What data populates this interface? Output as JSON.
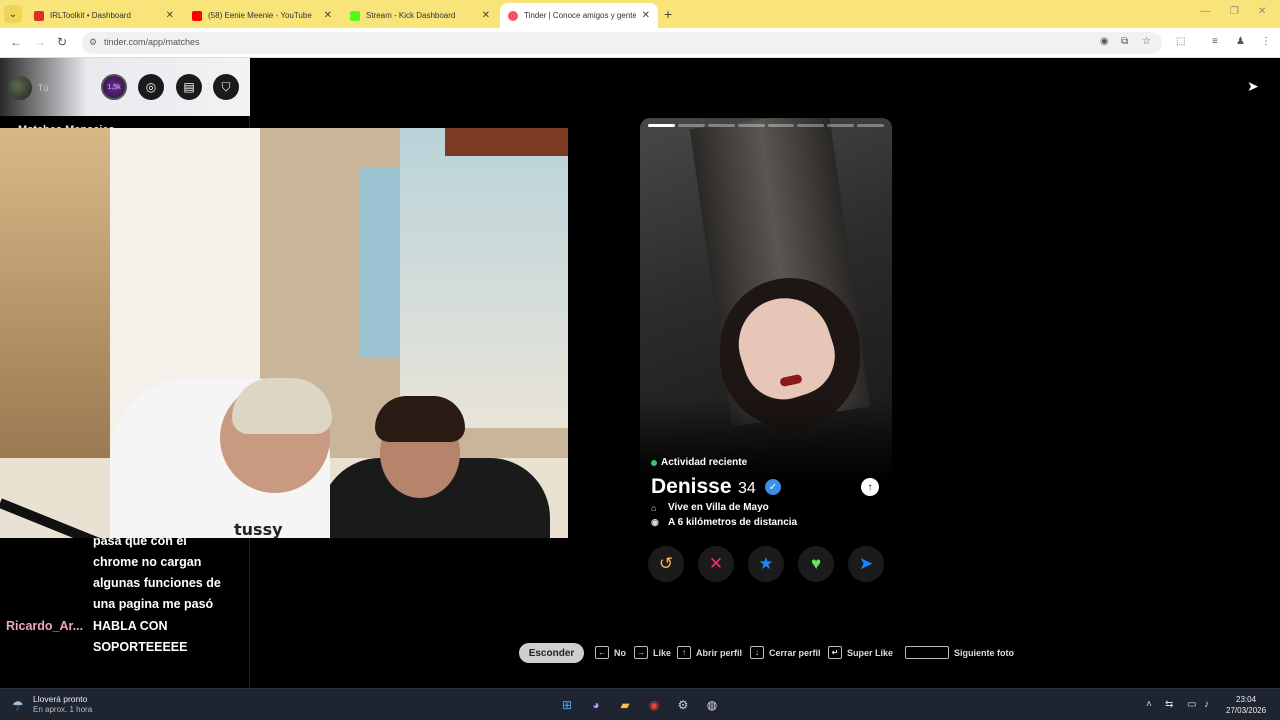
{
  "browser": {
    "tabs": [
      {
        "title": "IRLToolkit • Dashboard",
        "favicon_color": "#d93025"
      },
      {
        "title": "(58) Eenie Meenie - YouTube",
        "favicon_color": "#ff0000"
      },
      {
        "title": "Stream - Kick Dashboard",
        "favicon_color": "#53fc18"
      },
      {
        "title": "Tinder | Conoce amigos y gente",
        "favicon_color": "#fd5068"
      }
    ],
    "active_tab": 3,
    "url": "tinder.com/app/matches"
  },
  "tinder": {
    "you_label": "Tú",
    "gold_badge": "1,5k",
    "matches_heading": "Matches   Mensajes",
    "profile": {
      "activity": "Actividad reciente",
      "name": "Denisse",
      "age": "34",
      "lives_in": "Vive en Villa de Mayo",
      "distance": "A 6 kilómetros de distancia",
      "photo_count": 8,
      "current_photo": 1
    },
    "actions": [
      {
        "name": "rewind",
        "glyph": "↺",
        "color": "#f5b748"
      },
      {
        "name": "nope",
        "glyph": "✕",
        "color": "#fd267d"
      },
      {
        "name": "super-like",
        "glyph": "★",
        "color": "#1786ff"
      },
      {
        "name": "like",
        "glyph": "♥",
        "color": "#6ce45e"
      },
      {
        "name": "boost",
        "glyph": "➤",
        "color": "#1786ff"
      }
    ],
    "hints": {
      "hide": "Esconder",
      "no": "No",
      "like": "Like",
      "open": "Abrir perfil",
      "close": "Cerrar perfil",
      "super": "Super Like",
      "next": "Siguiente foto"
    }
  },
  "webcam": {
    "shirt_text": "tussy"
  },
  "chat": {
    "lines": [
      "pasa que con el",
      "chrome no cargan",
      "algunas funciones de",
      "una pagina me pasó",
      "HABLA CON",
      "SOPORTEEEEE"
    ],
    "user": "Ricardo_Ar..."
  },
  "taskbar": {
    "weather_title": "Lloverá pronto",
    "weather_sub": "En aprox. 1 hora",
    "time": "23:04",
    "date": "27/03/2026"
  }
}
